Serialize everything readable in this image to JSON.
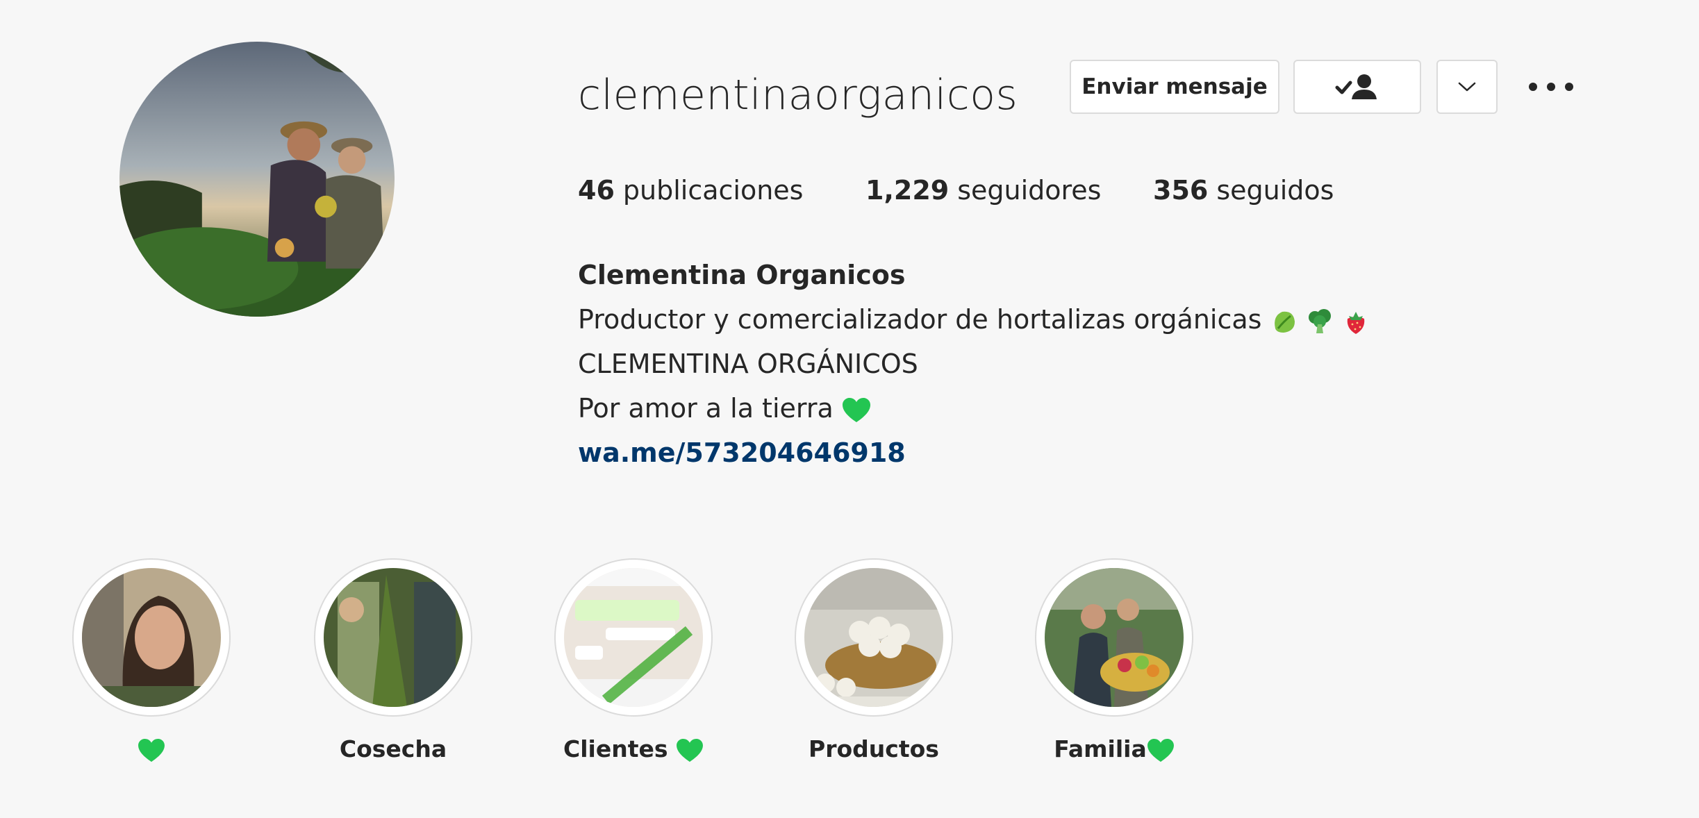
{
  "profile": {
    "username": "clementinaorganicos",
    "avatar_icon": "profile-photo",
    "buttons": {
      "message_label": "Enviar mensaje",
      "following_icon": "user-check-icon",
      "options_icon": "chevron-down-icon",
      "more_icon": "more-dots-icon"
    }
  },
  "stats": {
    "posts_count": "46",
    "posts_label": "publicaciones",
    "followers_count": "1,229",
    "followers_label": "seguidores",
    "following_count": "356",
    "following_label": "seguidos"
  },
  "bio": {
    "full_name": "Clementina Organicos",
    "line1": "Productor y comercializador de hortalizas orgánicas",
    "line1_emojis": [
      "lettuce-emoji",
      "broccoli-emoji",
      "strawberry-emoji"
    ],
    "line2": "CLEMENTINA ORGÁNICOS",
    "line3": "Por amor a la tierra",
    "line3_emoji": "green-heart-emoji",
    "link": "wa.me/573204646918"
  },
  "highlights": [
    {
      "label": "",
      "emoji": "green-heart-emoji"
    },
    {
      "label": "Cosecha",
      "emoji": ""
    },
    {
      "label": "Clientes",
      "emoji": "green-heart-emoji"
    },
    {
      "label": "Productos",
      "emoji": ""
    },
    {
      "label": "Familia",
      "emoji": "green-heart-emoji"
    }
  ],
  "colors": {
    "background": "#f7f7f7",
    "text": "#262626",
    "link": "#00376b",
    "border": "#dbdbdb",
    "green_heart": "#23c552"
  }
}
